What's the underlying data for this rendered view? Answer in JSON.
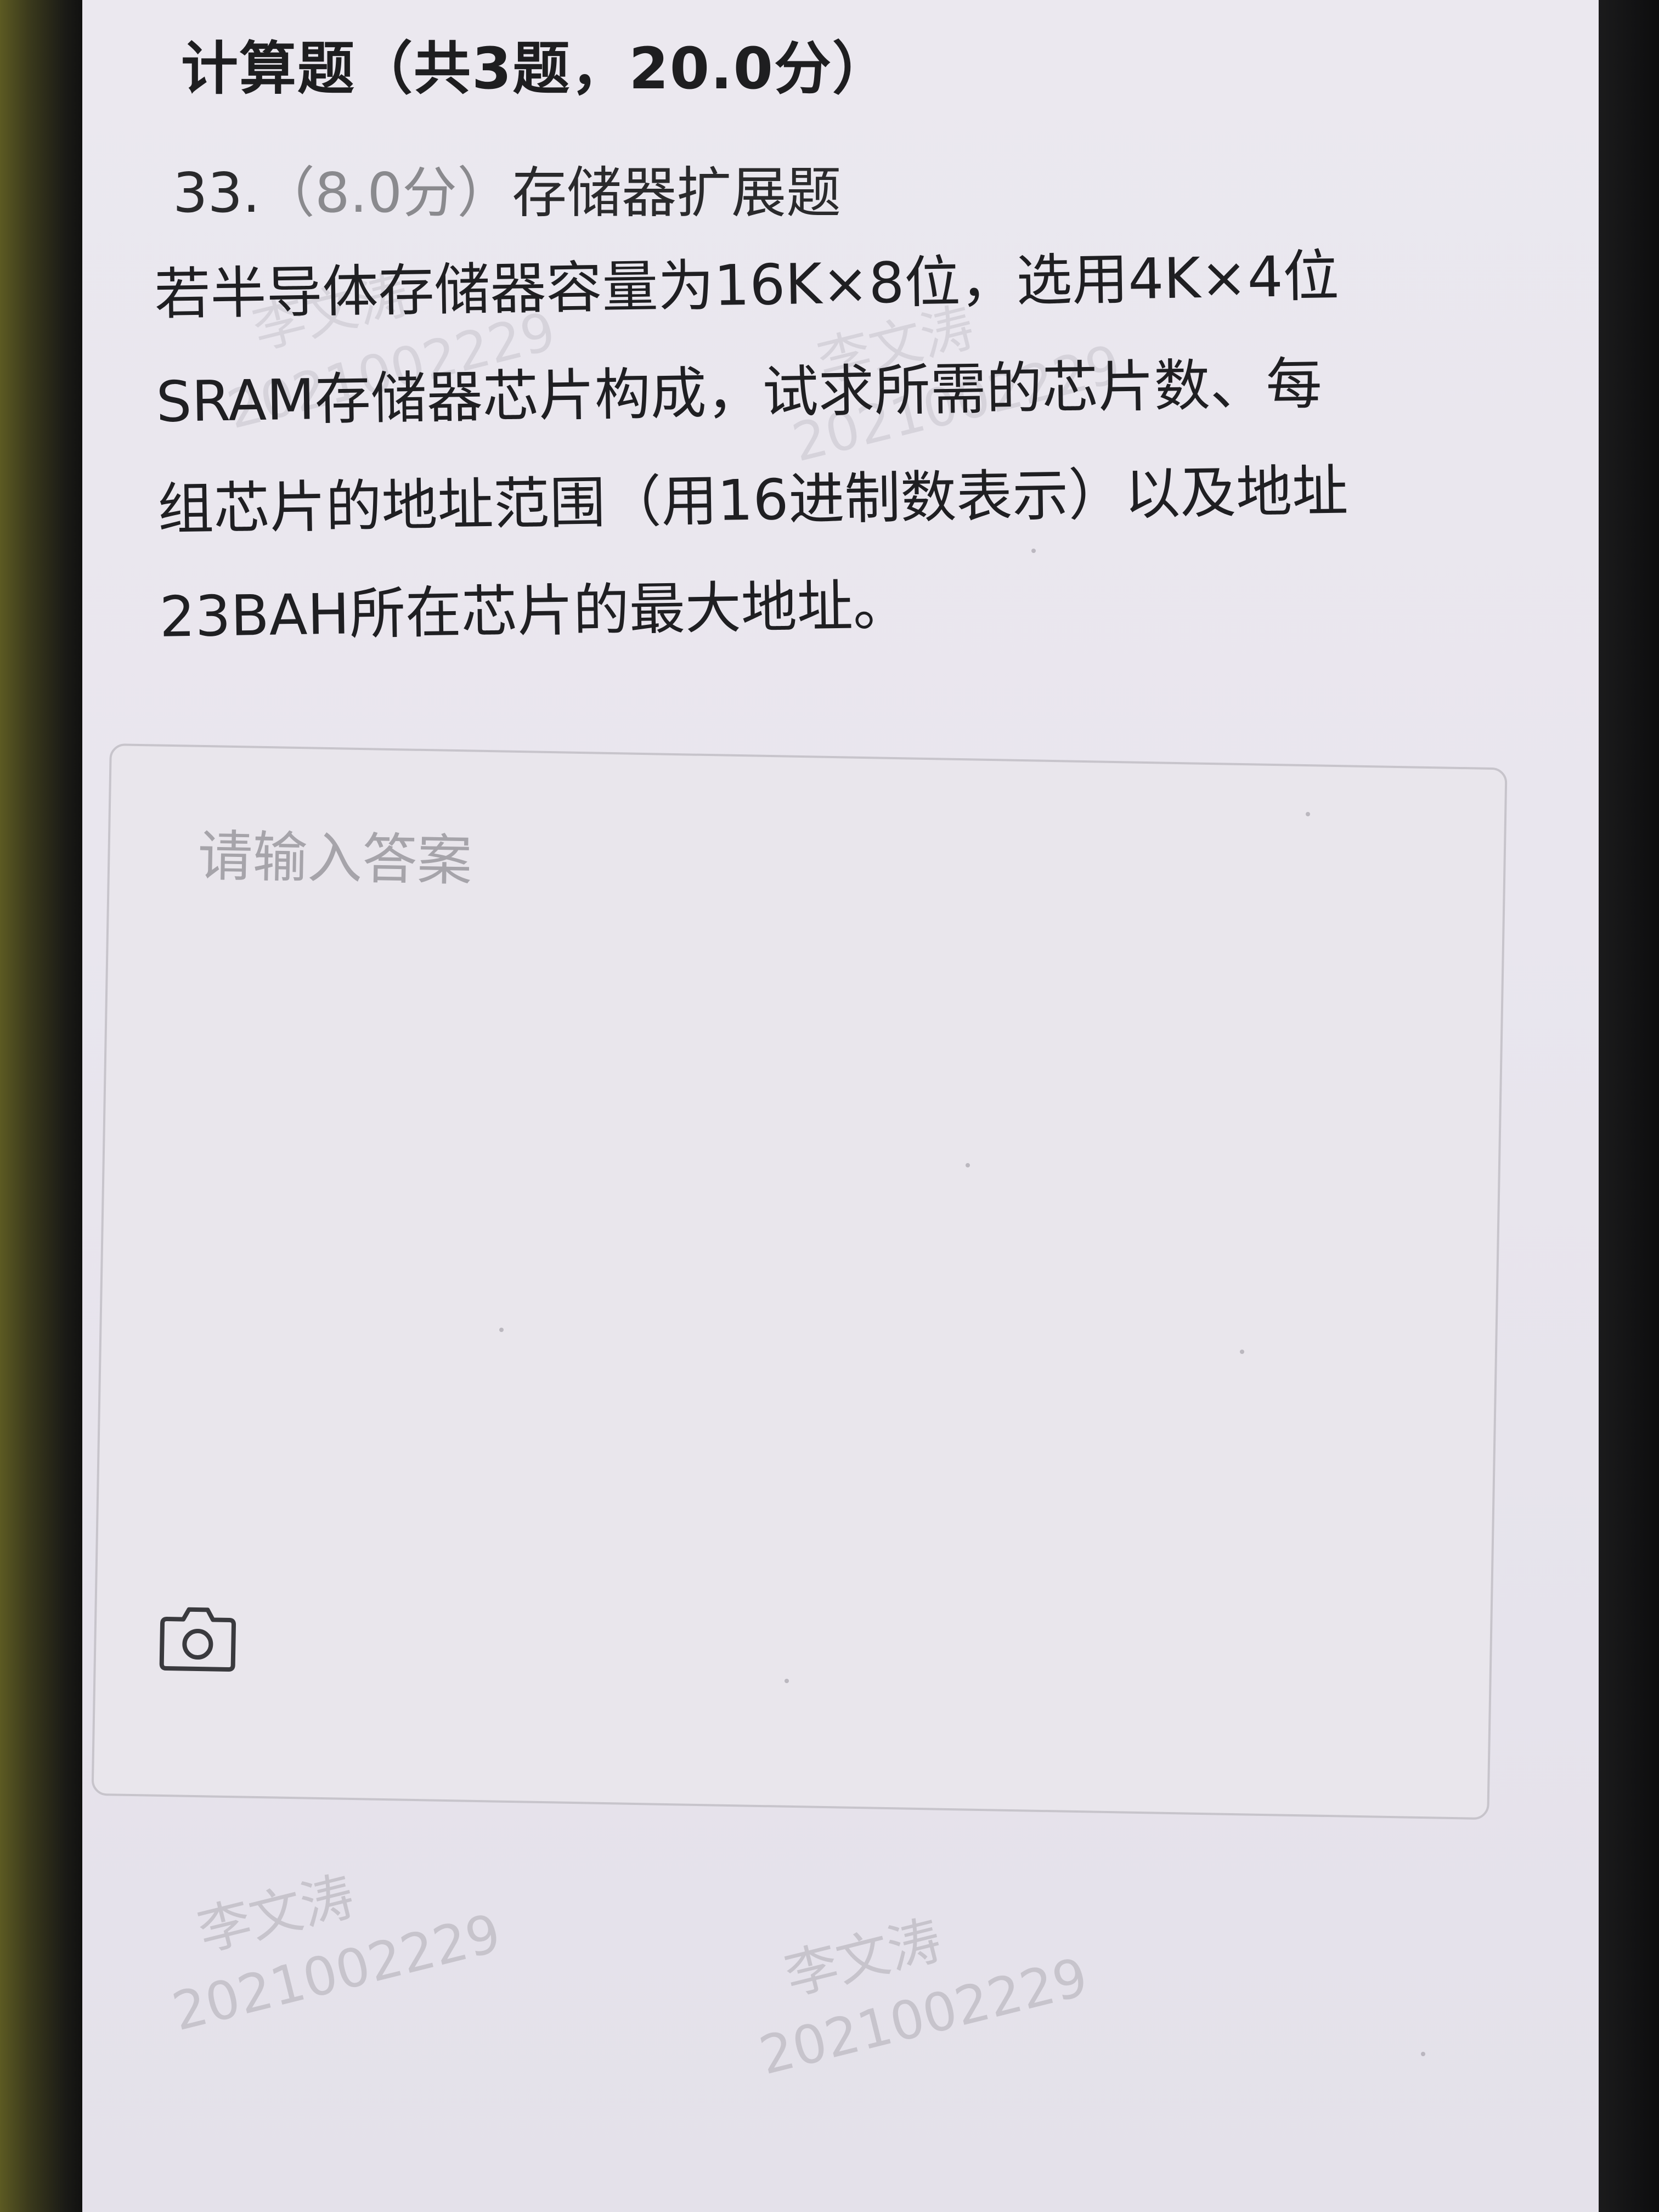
{
  "section": {
    "title": "计算题（共3题，20.0分）"
  },
  "question": {
    "number": "33.",
    "score": "（8.0分）",
    "type": "存储器扩展题",
    "lines": [
      "若半导体存储器容量为16K×8位，选用4K×4位",
      "SRAM存储器芯片构成，试求所需的芯片数、每",
      "组芯片的地址范围（用16进制数表示）以及地址",
      "23BAH所在芯片的最大地址。"
    ]
  },
  "answer": {
    "placeholder": "请输入答案",
    "camera_icon": "camera-icon"
  },
  "watermark": {
    "name": "李文涛",
    "id": "2021002229"
  }
}
